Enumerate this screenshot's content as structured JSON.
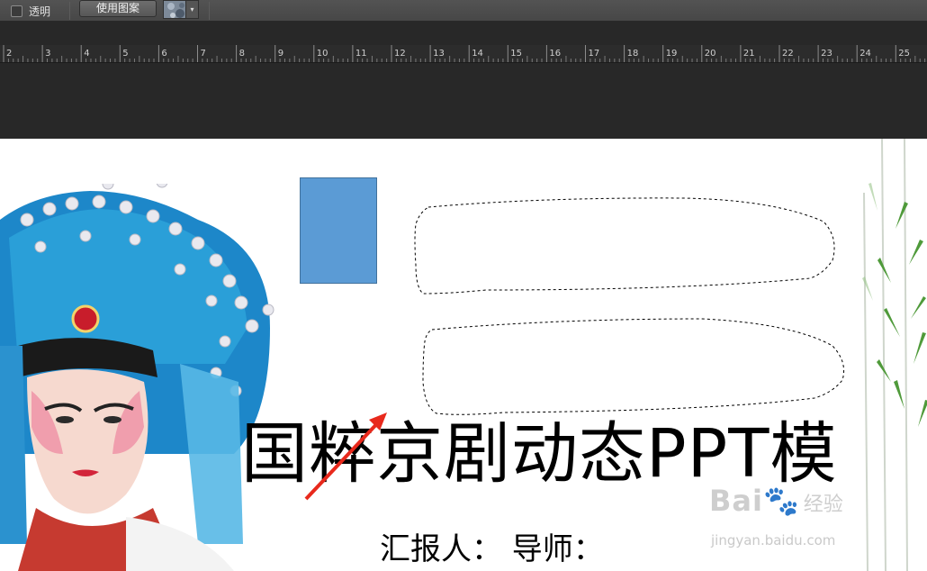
{
  "options_bar": {
    "transparent_label": "透明",
    "use_pattern_label": "使用图案",
    "pattern_caret": "▾"
  },
  "ruler": {
    "labels": [
      "2",
      "3",
      "4",
      "5",
      "6",
      "7",
      "8",
      "9",
      "10",
      "11",
      "12",
      "13",
      "14",
      "15",
      "16",
      "17",
      "18",
      "19",
      "20",
      "21",
      "22",
      "23",
      "24",
      "25"
    ]
  },
  "slide": {
    "title": "国粹京剧动态PPT模",
    "subtitle": "汇报人：  导师：",
    "shape_color": "#5b9bd5"
  },
  "watermark": {
    "logo": "Bai",
    "logo_tail": "经验",
    "url": "jingyan.baidu.com"
  },
  "colors": {
    "accent": "#5b9bd5",
    "arrow": "#e8291c"
  }
}
